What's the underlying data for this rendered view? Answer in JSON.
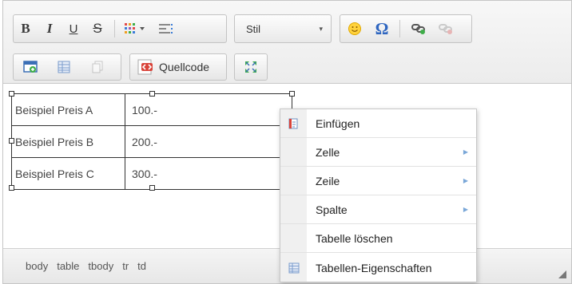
{
  "toolbar": {
    "format": {
      "bold": "B",
      "italic": "I",
      "underline": "U",
      "strike": "S"
    },
    "style_select": {
      "value": "Stil",
      "arrow": "▾"
    },
    "omega": "Ω",
    "source_button": {
      "label": "Quellcode"
    }
  },
  "table": {
    "rows": [
      [
        "Beispiel Preis A",
        "100.-"
      ],
      [
        "Beispiel Preis B",
        "200.-"
      ],
      [
        "Beispiel Preis C",
        "300.-"
      ]
    ]
  },
  "context_menu": {
    "items": [
      {
        "label": "Einfügen",
        "icon": "paste-icon",
        "submenu": false
      },
      {
        "label": "Zelle",
        "submenu": true
      },
      {
        "label": "Zeile",
        "submenu": true
      },
      {
        "label": "Spalte",
        "submenu": true
      },
      {
        "label": "Tabelle löschen",
        "submenu": false
      },
      {
        "label": "Tabellen-Eigenschaften",
        "icon": "table-properties-icon",
        "submenu": false
      }
    ],
    "submenu_arrow": "▶"
  },
  "statusbar": {
    "path": [
      "body",
      "table",
      "tbody",
      "tr",
      "td"
    ]
  }
}
